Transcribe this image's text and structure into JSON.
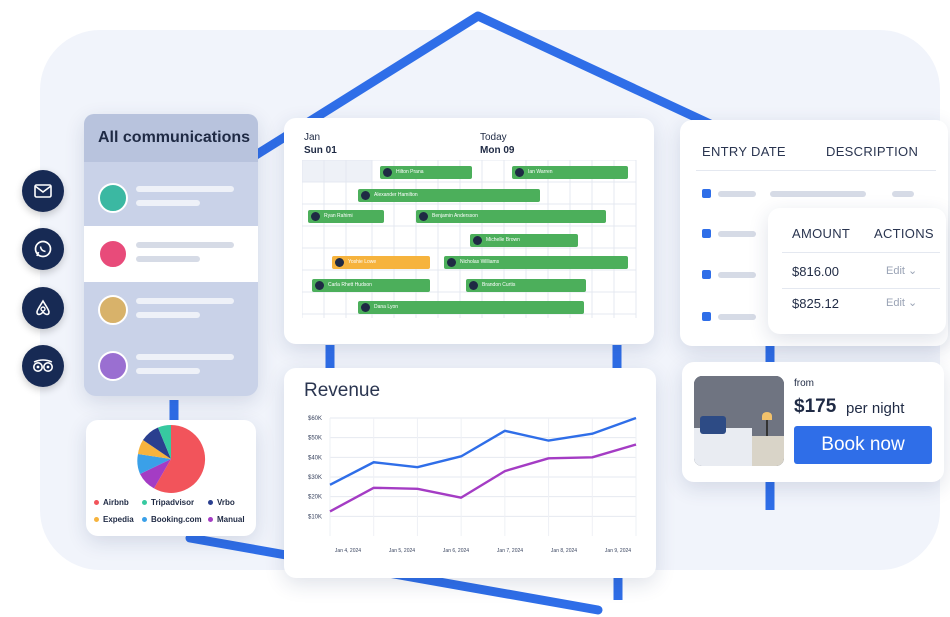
{
  "communications": {
    "title": "All communications"
  },
  "channels": [
    "mail-icon",
    "whatsapp-icon",
    "airbnb-icon",
    "tripadvisor-icon"
  ],
  "calendar": {
    "start_month": "Jan",
    "start_day": "Sun 01",
    "today_label": "Today",
    "today_day": "Mon 09",
    "bookings": [
      {
        "name": "Hilton Prana",
        "color": "#4caf5b"
      },
      {
        "name": "Ian Warren",
        "color": "#4caf5b"
      },
      {
        "name": "Alexander Hamilton",
        "color": "#4caf5b"
      },
      {
        "name": "Ryan Rahimi",
        "color": "#4caf5b"
      },
      {
        "name": "Benjamin Andersson",
        "color": "#4caf5b"
      },
      {
        "name": "Michelle Brown",
        "color": "#4caf5b"
      },
      {
        "name": "Yoshie Lowe",
        "color": "#f6b33d"
      },
      {
        "name": "Nicholas Williams",
        "color": "#4caf5b"
      },
      {
        "name": "Carla Rhett Hudson",
        "color": "#4caf5b"
      },
      {
        "name": "Brandon Curtis",
        "color": "#4caf5b"
      },
      {
        "name": "Dana Lyon",
        "color": "#4caf5b"
      }
    ]
  },
  "ledger": {
    "col_entry_date": "ENTRY DATE",
    "col_description": "DESCRIPTION",
    "col_amount": "AMOUNT",
    "col_actions": "ACTIONS",
    "rows": [
      {
        "amount": "$816.00",
        "action": "Edit"
      },
      {
        "amount": "$825.12",
        "action": "Edit"
      }
    ]
  },
  "booking": {
    "from_label": "from",
    "price": "$175",
    "per": "per night",
    "button": "Book now"
  },
  "sources_pie": {
    "legend": [
      {
        "label": "Airbnb",
        "color": "#f2545b"
      },
      {
        "label": "Tripadvisor",
        "color": "#37c9a0"
      },
      {
        "label": "Vrbo",
        "color": "#2a3f8f"
      },
      {
        "label": "Expedia",
        "color": "#f6b33d"
      },
      {
        "label": "Booking.com",
        "color": "#3aa0e8"
      },
      {
        "label": "Manual",
        "color": "#a43cc4"
      }
    ]
  },
  "chart_data": {
    "type": "line",
    "title": "Revenue",
    "xlabel": "",
    "ylabel": "",
    "ylim": [
      0,
      60000
    ],
    "y_ticks": [
      "$10K",
      "$20K",
      "$30K",
      "$40K",
      "$50K",
      "$60K"
    ],
    "x_ticks": [
      "Jan 4, 2024",
      "Jan 5, 2024",
      "Jan 6, 2024",
      "Jan 7, 2024",
      "Jan 8, 2024",
      "Jan 9, 2024"
    ],
    "series": [
      {
        "color": "#2f6ee8",
        "values": [
          26000,
          37500,
          35000,
          40500,
          53500,
          48500,
          52000,
          60000
        ]
      },
      {
        "color": "#a43cc4",
        "values": [
          12500,
          24500,
          24000,
          19500,
          33000,
          39500,
          40000,
          46500
        ]
      }
    ]
  }
}
